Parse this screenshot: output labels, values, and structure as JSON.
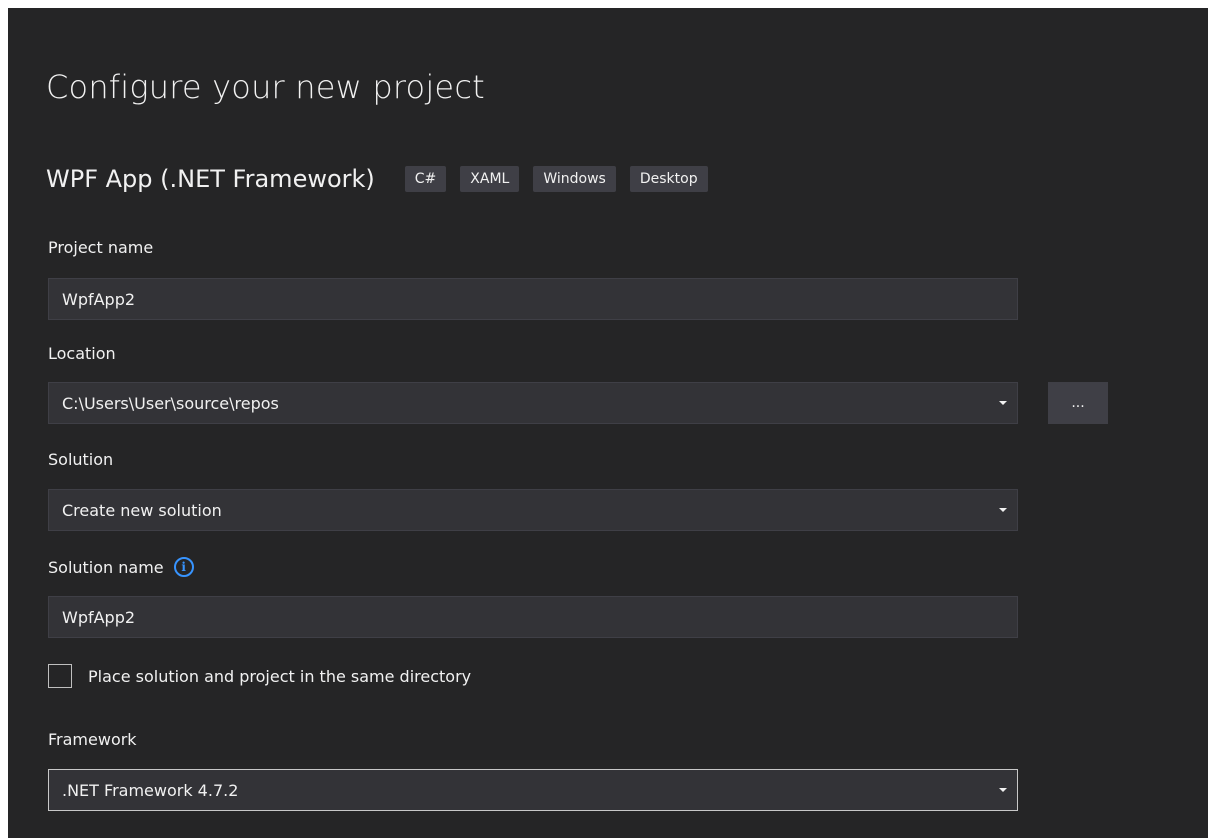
{
  "page": {
    "title": "Configure your new project",
    "template_name": "WPF App (.NET Framework)",
    "tags": [
      "C#",
      "XAML",
      "Windows",
      "Desktop"
    ]
  },
  "project_name": {
    "label": "Project name",
    "value": "WpfApp2"
  },
  "location": {
    "label": "Location",
    "value": "C:\\Users\\User\\source\\repos",
    "browse_label": "..."
  },
  "solution": {
    "label": "Solution",
    "value": "Create new solution"
  },
  "solution_name": {
    "label": "Solution name",
    "info_icon": "info-icon",
    "info_glyph": "i",
    "value": "WpfApp2"
  },
  "same_directory": {
    "label": "Place solution and project in the same directory",
    "checked": false
  },
  "framework": {
    "label": "Framework",
    "value": ".NET Framework 4.7.2"
  },
  "colors": {
    "background": "#252526",
    "field": "#333337",
    "tag": "#3f3f46",
    "text": "#f1f1f1",
    "accent": "#3794ff"
  }
}
